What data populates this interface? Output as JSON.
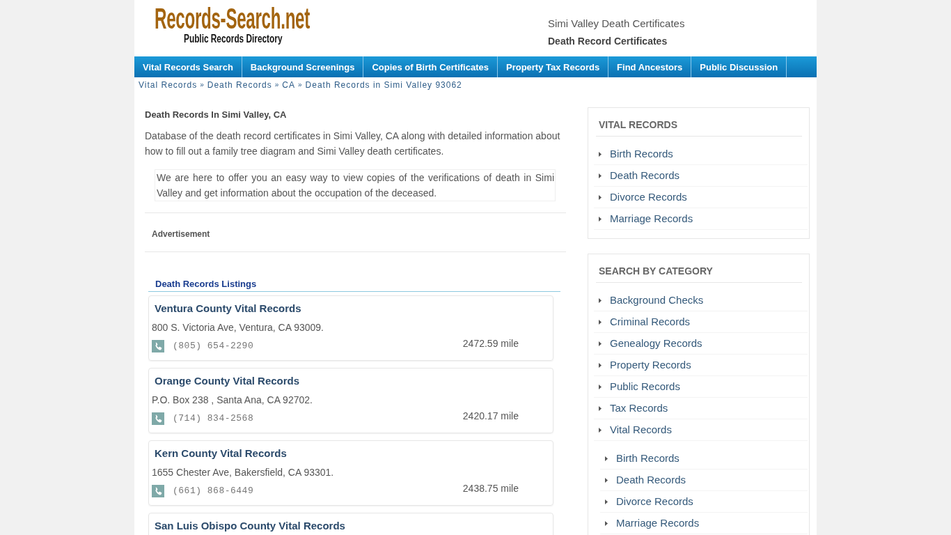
{
  "header": {
    "logo_title": "Records-Search.net",
    "logo_subtitle": "Public Records Directory",
    "tagline": "Simi Valley Death Certificates",
    "subtitle": "Death Record Certificates"
  },
  "nav": [
    "Vital Records Search",
    "Background Screenings",
    "Copies of Birth Certificates",
    "Property Tax Records",
    "Find Ancestors",
    "Public Discussion"
  ],
  "breadcrumb": {
    "separator": "»",
    "items": [
      "Vital Records",
      "Death Records",
      "CA",
      "Death Records in Simi Valley 93062"
    ]
  },
  "article": {
    "heading": "Death Records In Simi Valley, CA",
    "intro": "Database of the death record certificates in Simi Valley, CA along with detailed information about how to fill out a family tree diagram and Simi Valley death certificates.",
    "quote": "We are here to offer you an easy way to view copies of the verifications of death in Simi Valley and get information about the occupation of the deceased.",
    "advertisement": "Advertisement"
  },
  "listings": {
    "title": "Death Records Listings",
    "items": [
      {
        "name": "Ventura County Vital Records",
        "address": "800 S. Victoria Ave, Ventura, CA 93009.",
        "phone": "(805) 654-2290",
        "distance": "2472.59 mile"
      },
      {
        "name": "Orange County Vital Records",
        "address": "P.O. Box 238 , Santa Ana, CA 92702.",
        "phone": "(714) 834-2568",
        "distance": "2420.17 mile"
      },
      {
        "name": "Kern County Vital Records",
        "address": "1655 Chester Ave, Bakersfield, CA 93301.",
        "phone": "(661) 868-6449",
        "distance": "2438.75 mile"
      },
      {
        "name": "San Luis Obispo County Vital Records"
      }
    ]
  },
  "sidebar": [
    {
      "title": "VITAL RECORDS",
      "items": [
        {
          "label": "Birth Records"
        },
        {
          "label": "Death Records"
        },
        {
          "label": "Divorce Records"
        },
        {
          "label": "Marriage Records"
        }
      ]
    },
    {
      "title": "SEARCH BY CATEGORY",
      "items": [
        {
          "label": "Background Checks"
        },
        {
          "label": "Criminal Records"
        },
        {
          "label": "Genealogy Records"
        },
        {
          "label": "Property Records"
        },
        {
          "label": "Public Records"
        },
        {
          "label": "Tax Records"
        },
        {
          "label": "Vital Records",
          "children": [
            {
              "label": "Birth Records"
            },
            {
              "label": "Death Records"
            },
            {
              "label": "Divorce Records"
            },
            {
              "label": "Marriage Records"
            }
          ]
        }
      ]
    }
  ]
}
